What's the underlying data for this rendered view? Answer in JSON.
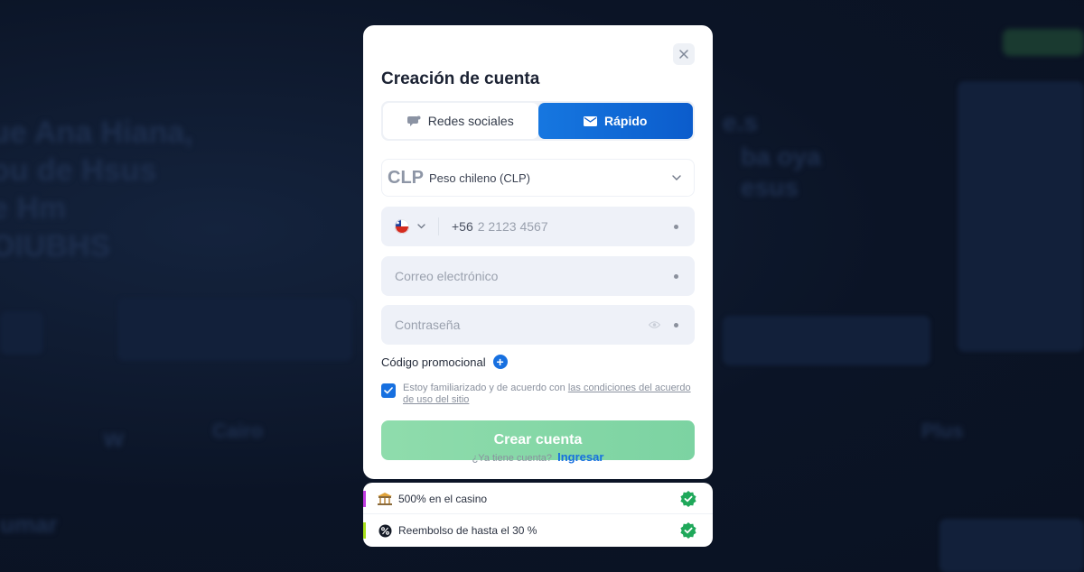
{
  "modal": {
    "title": "Creación de cuenta",
    "tabs": [
      {
        "label": "Redes sociales",
        "icon": "chat-bubbles-icon",
        "active": false
      },
      {
        "label": "Rápido",
        "icon": "envelope-icon",
        "active": true
      }
    ],
    "currency": {
      "code": "CLP",
      "name": "Peso chileno (CLP)"
    },
    "phone": {
      "country_flag": "chile-flag-icon",
      "dial_code": "+56",
      "placeholder": "2 2123 4567"
    },
    "email": {
      "placeholder": "Correo electrónico"
    },
    "password": {
      "placeholder": "Contraseña"
    },
    "promo": {
      "label": "Código promocional"
    },
    "terms": {
      "checked": true,
      "text": "Estoy familiarizado y de acuerdo con",
      "link": "las condiciones del acuerdo de uso del sitio"
    },
    "submit_label": "Crear cuenta",
    "login_prompt": "¿Ya tiene cuenta?",
    "login_link": "Ingresar"
  },
  "bonuses": [
    {
      "label": "500% en el casino",
      "icon": "casino-building-icon",
      "accent": "#c03be0"
    },
    {
      "label": "Reembolso de hasta el 30 %",
      "icon": "cashback-coin-icon",
      "accent": "#a7e01b"
    }
  ],
  "colors": {
    "primary": "#1770e0",
    "submit": "#8fdcac",
    "check_green": "#1fa85a"
  }
}
